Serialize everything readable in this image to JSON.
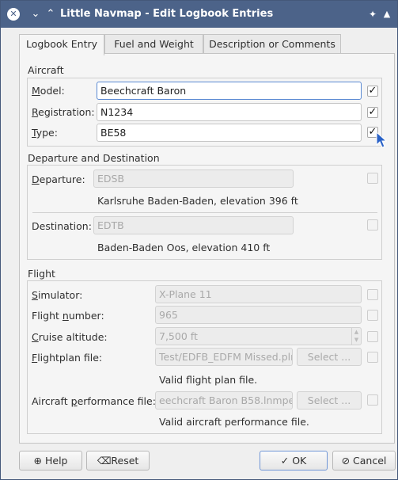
{
  "window": {
    "title": "Little Navmap - Edit Logbook Entries"
  },
  "tabs": [
    "Logbook Entry",
    "Fuel and Weight",
    "Description or Comments"
  ],
  "aircraft": {
    "section": "Aircraft",
    "model": {
      "label_u": "M",
      "label_rest": "odel:",
      "value": "Beechcraft Baron"
    },
    "registration": {
      "label_u": "R",
      "label_rest": "egistration:",
      "value": "N1234"
    },
    "type": {
      "label_u": "T",
      "label_rest": "ype:",
      "value": "BE58"
    }
  },
  "dep_dest": {
    "section": "Departure and Destination",
    "departure": {
      "label_u": "D",
      "label_rest": "eparture:",
      "value": "EDSB",
      "info": "Karlsruhe Baden-Baden,   elevation 396 ft"
    },
    "destination": {
      "label": "Destination:",
      "value": "EDTB",
      "info": "Baden-Baden Oos,   elevation 410 ft"
    }
  },
  "flight": {
    "section": "Flight",
    "simulator": {
      "label_u": "S",
      "label_rest": "imulator:",
      "value": "X-Plane 11"
    },
    "flight_number": {
      "label_a": "Flight ",
      "label_u": "n",
      "label_rest": "umber:",
      "value": "965"
    },
    "cruise_altitude": {
      "label_u": "C",
      "label_rest": "ruise altitude:",
      "value": "7,500 ft"
    },
    "flightplan_file": {
      "label_u": "F",
      "label_rest": "lightplan file:",
      "value": "Test/EDFB_EDFM Missed.pln",
      "select": "Select ...",
      "info": "Valid flight plan file."
    },
    "perf_file": {
      "label_a": "Aircraft ",
      "label_u": "p",
      "label_rest": "erformance file:",
      "value": "eechcraft Baron B58.lnmperf",
      "select": "Select ...",
      "info": "Valid aircraft performance file."
    }
  },
  "footer": {
    "help": "Help",
    "reset": "Reset",
    "ok": "OK",
    "cancel": "Cancel"
  }
}
